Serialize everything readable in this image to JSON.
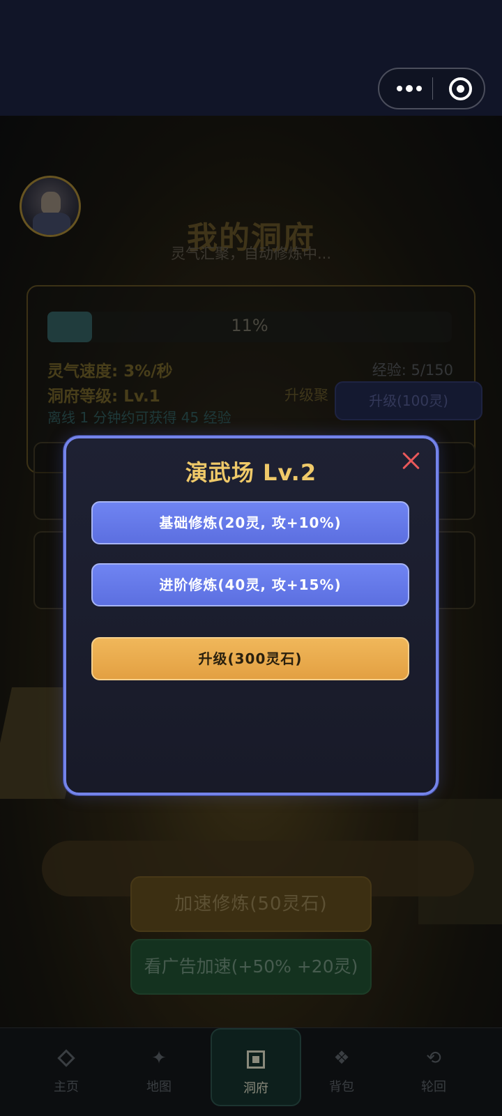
{
  "header": {
    "more_icon": "more-dots-icon",
    "capsule_close_icon": "target-circle-icon"
  },
  "background": {
    "title": "我的洞府",
    "subtitle": "灵气汇聚，自动修炼中...",
    "progress": {
      "value": 0.11,
      "label": "11%"
    },
    "speed": "灵气速度: 3%/秒",
    "level": "洞府等级: Lv.1",
    "exp": "经验: 5/150",
    "gather": "升级聚",
    "offline": "离线 1 分钟约可获得 45 经验",
    "upgrade_button": "升级(100灵)",
    "speed_button": "加速修炼(50灵石)",
    "ad_button": "看广告加速(+50% +20灵)"
  },
  "modal": {
    "title": "演武场 Lv.2",
    "buttons": [
      {
        "label": "基础修炼(20灵, 攻+10%)"
      },
      {
        "label": "进阶修炼(40灵, 攻+15%)"
      },
      {
        "label": "升级(300灵石)"
      }
    ],
    "colors": {
      "border": "#7484ea",
      "title": "#efc969",
      "close": "#e8585a",
      "primary": "#6276e6",
      "upgrade": "#eaad4e"
    }
  },
  "bottom_nav": {
    "items": [
      {
        "label": "主页",
        "icon": "diamond-icon"
      },
      {
        "label": "地图",
        "icon": "sparkle-icon"
      },
      {
        "label": "洞府",
        "icon": "cave-square-icon",
        "active": true
      },
      {
        "label": "背包",
        "icon": "grid-dots-icon"
      },
      {
        "label": "轮回",
        "icon": "cycle-icon"
      }
    ]
  }
}
